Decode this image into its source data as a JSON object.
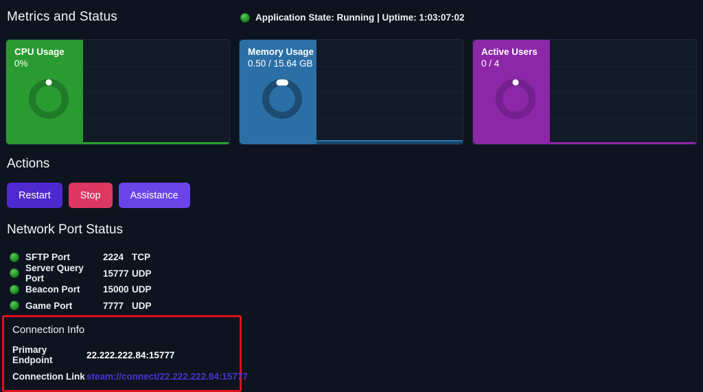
{
  "page": {
    "title": "Metrics and Status"
  },
  "status": {
    "text": "Application State: Running | Uptime: 1:03:07:02",
    "dot_icon": "green-status-dot",
    "dot_color": "#23912a"
  },
  "cards": [
    {
      "title": "CPU Usage",
      "value": "0%",
      "panel_color": "#2a9b31",
      "ring_color": "#1f7b27",
      "spark_color": "#2aa32e",
      "gauge_percent": 0
    },
    {
      "title": "Memory Usage",
      "value": "0.50 / 15.64 GB",
      "panel_color": "#2b6fa6",
      "ring_color": "#1d4b72",
      "spark_color": "#2d74ad",
      "gauge_percent": 3.2
    },
    {
      "title": "Active Users",
      "value": "0 / 4",
      "panel_color": "#8c27a8",
      "ring_color": "#741f8e",
      "spark_color": "#8c27a8",
      "gauge_percent": 0
    }
  ],
  "actions": {
    "heading": "Actions",
    "buttons": [
      {
        "label": "Restart",
        "color": "#4e29cf"
      },
      {
        "label": "Stop",
        "color": "#dc3862"
      },
      {
        "label": "Assistance",
        "color": "#6b44e8"
      }
    ]
  },
  "ports": {
    "heading": "Network Port Status",
    "status_dot_color": "#23912a",
    "rows": [
      {
        "name": "SFTP Port",
        "port": "2224",
        "protocol": "TCP"
      },
      {
        "name": "Server Query Port",
        "port": "15777",
        "protocol": "UDP"
      },
      {
        "name": "Beacon Port",
        "port": "15000",
        "protocol": "UDP"
      },
      {
        "name": "Game Port",
        "port": "7777",
        "protocol": "UDP"
      }
    ]
  },
  "connection": {
    "heading": "Connection Info",
    "highlight_border_color": "#df121b",
    "link_color": "#4c33cf",
    "rows": [
      {
        "label": "Primary Endpoint",
        "value": "22.222.222.84:15777"
      },
      {
        "label": "Connection Link",
        "value": "steam://connect/22.222.222.84:15777"
      }
    ]
  }
}
